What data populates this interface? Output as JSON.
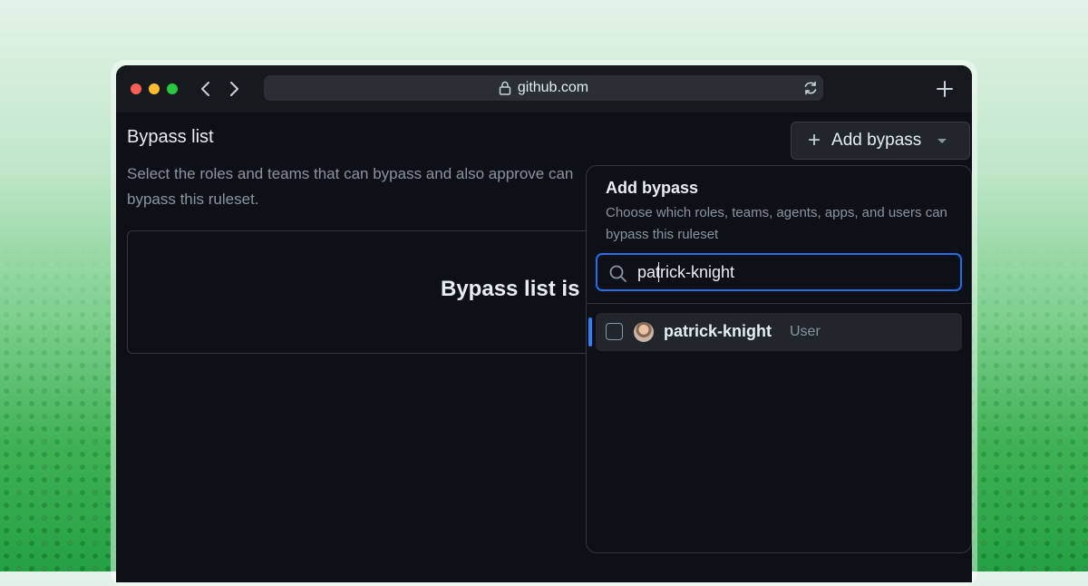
{
  "browser": {
    "url": "github.com",
    "traffic_light_colors": [
      "#ff5f57",
      "#febc2e",
      "#28c840"
    ],
    "icons": {
      "back": "chevron-left-icon",
      "forward": "chevron-right-icon",
      "lock": "lock-icon",
      "reload": "reload-icon",
      "new_tab": "plus-icon"
    }
  },
  "page": {
    "section_title": "Bypass list",
    "section_description": "Select the roles and teams that can bypass and also approve can bypass this ruleset.",
    "empty_state_text": "Bypass list is",
    "add_bypass_button": "Add bypass"
  },
  "dropdown": {
    "title": "Add bypass",
    "description": "Choose which roles, teams, agents, apps, and users can bypass this ruleset",
    "search_value": "patrick-knight",
    "results": [
      {
        "name": "patrick-knight",
        "type": "User",
        "checked": false,
        "selected": true
      }
    ]
  },
  "colors": {
    "accent_blue": "#2f81f7",
    "focus_border": "#1f6feb",
    "window_bg": "#0d1117"
  }
}
